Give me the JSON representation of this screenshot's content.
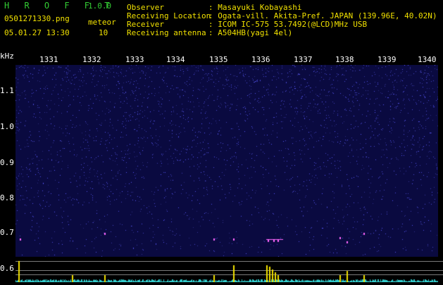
{
  "header": {
    "app_title": "H R O F F T",
    "version": "1.0.0",
    "filename": "0501271330.png",
    "datetime": "05.01.27 13:30",
    "meteor_label": "meteor",
    "meteor_count": "10"
  },
  "observation": {
    "rows": [
      {
        "label": "Observer",
        "value": ": Masayuki Kobayashi"
      },
      {
        "label": "Receiving Location",
        "value": ": Ogata-vill. Akita-Pref. JAPAN (139.96E, 40.02N)"
      },
      {
        "label": "Receiver",
        "value": ": ICOM IC-575 53.7492(@LCD)MHz USB"
      },
      {
        "label": "Receiving antenna",
        "value": ": A504HB(yagi 4el)"
      }
    ]
  },
  "axis": {
    "freq_unit": "kHz",
    "freq_ticks": [
      "1.1",
      "1.0",
      "0.9",
      "0.8",
      "0.7",
      "0.6"
    ],
    "time_ticks": [
      "1331",
      "1332",
      "1333",
      "1334",
      "1335",
      "1336",
      "1337",
      "1338",
      "1339",
      "1340"
    ]
  },
  "colors": {
    "background": "#000000",
    "spectrogram_base": "#0a0a40",
    "noise": "#4a4aff",
    "echo": "#ff66ff",
    "strip_yellow": "#f0e000",
    "strip_cyan": "#33cccc"
  }
}
